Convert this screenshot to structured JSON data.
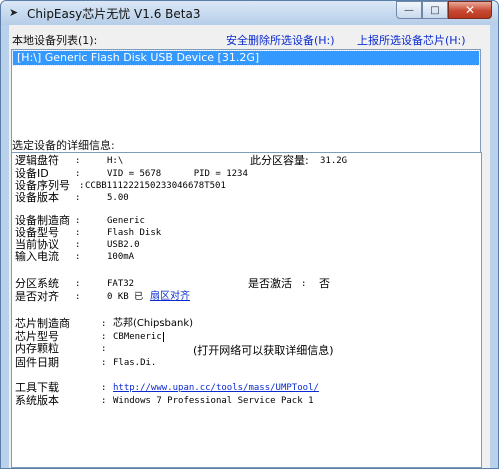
{
  "window": {
    "title": "ChipEasy芯片无忧 V1.6 Beta3",
    "caption": {
      "minimize": "—",
      "maximize": "□",
      "close": "✕"
    }
  },
  "header": {
    "device_list_label": "本地设备列表(1):",
    "safe_remove_link": "安全删除所选设备(H:)",
    "report_chip_link": "上报所选设备芯片(H:)"
  },
  "devices": [
    {
      "label": "[H:\\] Generic Flash Disk USB Device [31.2G]",
      "selected": true
    }
  ],
  "details": {
    "heading": "选定设备的详细信息:",
    "logical_drive": {
      "key": "逻辑盘符",
      "value": "H:\\"
    },
    "partition_capacity": {
      "key": "此分区容量:",
      "value": "31.2G"
    },
    "device_id": {
      "key": "设备ID",
      "value": "VID = 5678      PID = 1234"
    },
    "serial": {
      "key": "设备序列号",
      "value": "CCBB111222150233046678T501"
    },
    "version": {
      "key": "设备版本",
      "value": "5.00"
    },
    "manufacturer": {
      "key": "设备制造商",
      "value": "Generic"
    },
    "model": {
      "key": "设备型号",
      "value": "Flash Disk"
    },
    "protocol": {
      "key": "当前协议",
      "value": "USB2.0"
    },
    "current": {
      "key": "输入电流",
      "value": "100mA"
    },
    "filesystem": {
      "key": "分区系统",
      "value": "FAT32"
    },
    "active": {
      "key": "是否激活",
      "value": "否"
    },
    "aligned": {
      "key": "是否对齐",
      "value": "0 KB 已",
      "link": "扇区对齐"
    },
    "chip_vendor": {
      "key": "芯片制造商",
      "value": "芯邦(Chipsbank)"
    },
    "chip_model": {
      "key": "芯片型号",
      "value": "CBMeneric"
    },
    "flash": {
      "key": "内存颗粒",
      "value": ""
    },
    "network_note": "(打开网络可以获取详细信息)",
    "firmware_date": {
      "key": "固件日期",
      "value": "Flas.Di."
    },
    "tool_download": {
      "key": "工具下载",
      "value": "http://www.upan.cc/tools/mass/UMPTool/"
    },
    "os_version": {
      "key": "系统版本",
      "value": "Windows 7 Professional Service Pack 1"
    },
    "colon": ":"
  }
}
